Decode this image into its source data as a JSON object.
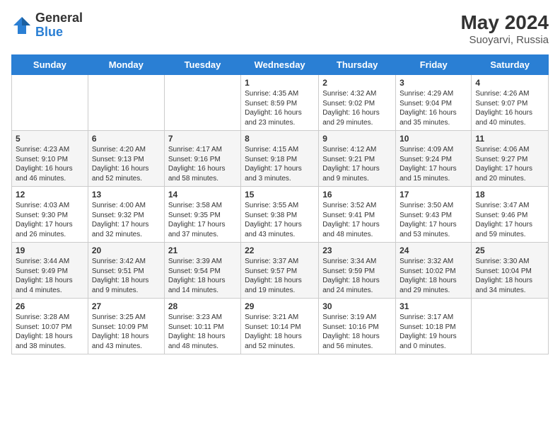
{
  "header": {
    "logo_general": "General",
    "logo_blue": "Blue",
    "month_year": "May 2024",
    "location": "Suoyarvi, Russia"
  },
  "days_of_week": [
    "Sunday",
    "Monday",
    "Tuesday",
    "Wednesday",
    "Thursday",
    "Friday",
    "Saturday"
  ],
  "weeks": [
    [
      {
        "day": "",
        "info": ""
      },
      {
        "day": "",
        "info": ""
      },
      {
        "day": "",
        "info": ""
      },
      {
        "day": "1",
        "info": "Sunrise: 4:35 AM\nSunset: 8:59 PM\nDaylight: 16 hours\nand 23 minutes."
      },
      {
        "day": "2",
        "info": "Sunrise: 4:32 AM\nSunset: 9:02 PM\nDaylight: 16 hours\nand 29 minutes."
      },
      {
        "day": "3",
        "info": "Sunrise: 4:29 AM\nSunset: 9:04 PM\nDaylight: 16 hours\nand 35 minutes."
      },
      {
        "day": "4",
        "info": "Sunrise: 4:26 AM\nSunset: 9:07 PM\nDaylight: 16 hours\nand 40 minutes."
      }
    ],
    [
      {
        "day": "5",
        "info": "Sunrise: 4:23 AM\nSunset: 9:10 PM\nDaylight: 16 hours\nand 46 minutes."
      },
      {
        "day": "6",
        "info": "Sunrise: 4:20 AM\nSunset: 9:13 PM\nDaylight: 16 hours\nand 52 minutes."
      },
      {
        "day": "7",
        "info": "Sunrise: 4:17 AM\nSunset: 9:16 PM\nDaylight: 16 hours\nand 58 minutes."
      },
      {
        "day": "8",
        "info": "Sunrise: 4:15 AM\nSunset: 9:18 PM\nDaylight: 17 hours\nand 3 minutes."
      },
      {
        "day": "9",
        "info": "Sunrise: 4:12 AM\nSunset: 9:21 PM\nDaylight: 17 hours\nand 9 minutes."
      },
      {
        "day": "10",
        "info": "Sunrise: 4:09 AM\nSunset: 9:24 PM\nDaylight: 17 hours\nand 15 minutes."
      },
      {
        "day": "11",
        "info": "Sunrise: 4:06 AM\nSunset: 9:27 PM\nDaylight: 17 hours\nand 20 minutes."
      }
    ],
    [
      {
        "day": "12",
        "info": "Sunrise: 4:03 AM\nSunset: 9:30 PM\nDaylight: 17 hours\nand 26 minutes."
      },
      {
        "day": "13",
        "info": "Sunrise: 4:00 AM\nSunset: 9:32 PM\nDaylight: 17 hours\nand 32 minutes."
      },
      {
        "day": "14",
        "info": "Sunrise: 3:58 AM\nSunset: 9:35 PM\nDaylight: 17 hours\nand 37 minutes."
      },
      {
        "day": "15",
        "info": "Sunrise: 3:55 AM\nSunset: 9:38 PM\nDaylight: 17 hours\nand 43 minutes."
      },
      {
        "day": "16",
        "info": "Sunrise: 3:52 AM\nSunset: 9:41 PM\nDaylight: 17 hours\nand 48 minutes."
      },
      {
        "day": "17",
        "info": "Sunrise: 3:50 AM\nSunset: 9:43 PM\nDaylight: 17 hours\nand 53 minutes."
      },
      {
        "day": "18",
        "info": "Sunrise: 3:47 AM\nSunset: 9:46 PM\nDaylight: 17 hours\nand 59 minutes."
      }
    ],
    [
      {
        "day": "19",
        "info": "Sunrise: 3:44 AM\nSunset: 9:49 PM\nDaylight: 18 hours\nand 4 minutes."
      },
      {
        "day": "20",
        "info": "Sunrise: 3:42 AM\nSunset: 9:51 PM\nDaylight: 18 hours\nand 9 minutes."
      },
      {
        "day": "21",
        "info": "Sunrise: 3:39 AM\nSunset: 9:54 PM\nDaylight: 18 hours\nand 14 minutes."
      },
      {
        "day": "22",
        "info": "Sunrise: 3:37 AM\nSunset: 9:57 PM\nDaylight: 18 hours\nand 19 minutes."
      },
      {
        "day": "23",
        "info": "Sunrise: 3:34 AM\nSunset: 9:59 PM\nDaylight: 18 hours\nand 24 minutes."
      },
      {
        "day": "24",
        "info": "Sunrise: 3:32 AM\nSunset: 10:02 PM\nDaylight: 18 hours\nand 29 minutes."
      },
      {
        "day": "25",
        "info": "Sunrise: 3:30 AM\nSunset: 10:04 PM\nDaylight: 18 hours\nand 34 minutes."
      }
    ],
    [
      {
        "day": "26",
        "info": "Sunrise: 3:28 AM\nSunset: 10:07 PM\nDaylight: 18 hours\nand 38 minutes."
      },
      {
        "day": "27",
        "info": "Sunrise: 3:25 AM\nSunset: 10:09 PM\nDaylight: 18 hours\nand 43 minutes."
      },
      {
        "day": "28",
        "info": "Sunrise: 3:23 AM\nSunset: 10:11 PM\nDaylight: 18 hours\nand 48 minutes."
      },
      {
        "day": "29",
        "info": "Sunrise: 3:21 AM\nSunset: 10:14 PM\nDaylight: 18 hours\nand 52 minutes."
      },
      {
        "day": "30",
        "info": "Sunrise: 3:19 AM\nSunset: 10:16 PM\nDaylight: 18 hours\nand 56 minutes."
      },
      {
        "day": "31",
        "info": "Sunrise: 3:17 AM\nSunset: 10:18 PM\nDaylight: 19 hours\nand 0 minutes."
      },
      {
        "day": "",
        "info": ""
      }
    ]
  ]
}
